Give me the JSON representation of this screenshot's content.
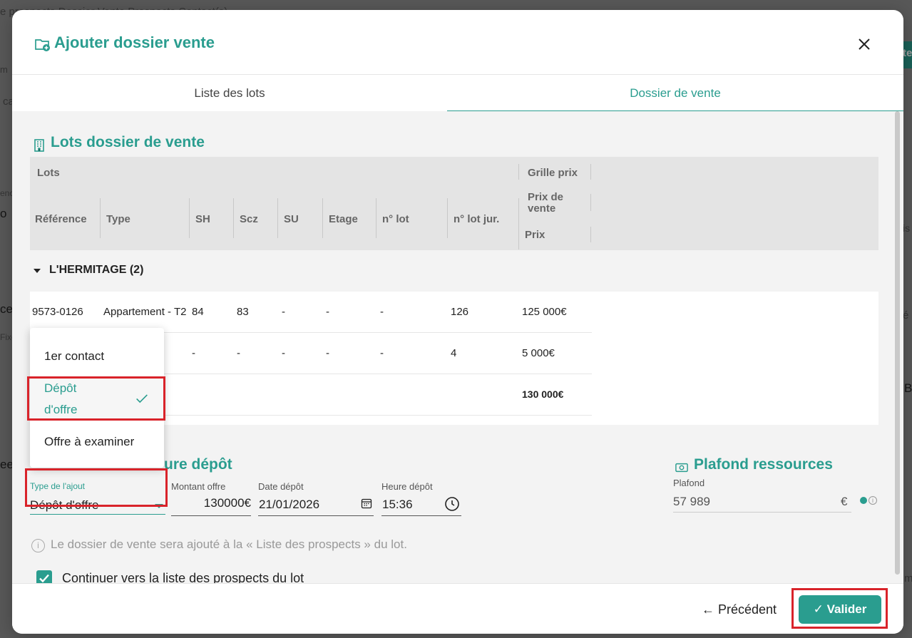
{
  "background": {
    "breadcrumb": "e prospects   Dossier Vente   Prospects   Contact(s)",
    "frag_m": "m",
    "frag_ca": "ca",
    "frag_eno": "eno",
    "frag_o": "o",
    "frag_ce": "ce",
    "frag_fixe": "Fixe",
    "frag_ee": "ee",
    "frag_te": "te",
    "frag_is": "is",
    "frag_e": "é",
    "frag_b": "B",
    "frag_m2": "m"
  },
  "dialog": {
    "title": "Ajouter dossier vente",
    "title_icon": "folder-add-icon",
    "close_icon": "close-icon"
  },
  "tabs": [
    {
      "label": "Liste des lots",
      "active": false
    },
    {
      "label": "Dossier de vente",
      "active": true
    }
  ],
  "lots_section": {
    "title": "Lots dossier de vente",
    "icon": "building-icon",
    "group_headers": {
      "lots": "Lots",
      "grille": "Grille prix"
    },
    "columns": [
      "Référence",
      "Type",
      "SH",
      "Scz",
      "SU",
      "Etage",
      "n° lot",
      "n° lot jur.",
      "Prix de vente",
      "Prix"
    ],
    "group": {
      "label": "L'HERMITAGE (2)"
    },
    "rows": [
      {
        "ref": "9573-0126",
        "type": "Appartement - T2",
        "sh": "84",
        "scz": "83",
        "su": "-",
        "etage": "-",
        "lot": "-",
        "lotjur": "126",
        "prix": "125 000€"
      },
      {
        "ref": "",
        "type": "",
        "sh": "-",
        "scz": "-",
        "su": "-",
        "etage": "-",
        "lot": "-",
        "lotjur": "4",
        "prix": "5 000€"
      }
    ],
    "total": "130 000€"
  },
  "dropdown": {
    "options": [
      {
        "label": "1er contact",
        "selected": false
      },
      {
        "label": "Dépôt d'offre",
        "label_line1": "Dépôt",
        "label_line2": "d'offre",
        "selected": true
      },
      {
        "label": "Offre à examiner",
        "selected": false
      }
    ],
    "check_icon": "check-icon"
  },
  "depot_section": {
    "title_partial": "ure dépôt",
    "type_label": "Type de l'ajout",
    "type_value": "Dépôt d'offre",
    "montant_label": "Montant offre",
    "montant_value": "130000",
    "montant_unit": "€",
    "date_label": "Date dépôt",
    "date_value": "21/01/2026",
    "date_icon": "calendar-icon",
    "heure_label": "Heure dépôt",
    "heure_value": "15:36",
    "heure_icon": "clock-icon"
  },
  "plafond_section": {
    "title": "Plafond ressources",
    "icon": "money-icon",
    "label": "Plafond",
    "value": "57 989",
    "unit": "€",
    "info_icon": "info-icon"
  },
  "info": {
    "text": "Le dossier de vente sera ajouté à la « Liste des prospects » du lot.",
    "icon_glyph": "i"
  },
  "checkbox": {
    "label": "Continuer vers la liste des prospects du lot",
    "checked": true
  },
  "footer": {
    "prev": "← Précédent",
    "valid": "✓ Valider"
  },
  "colors": {
    "accent": "#2a9d8f",
    "highlight": "#d9232a"
  }
}
